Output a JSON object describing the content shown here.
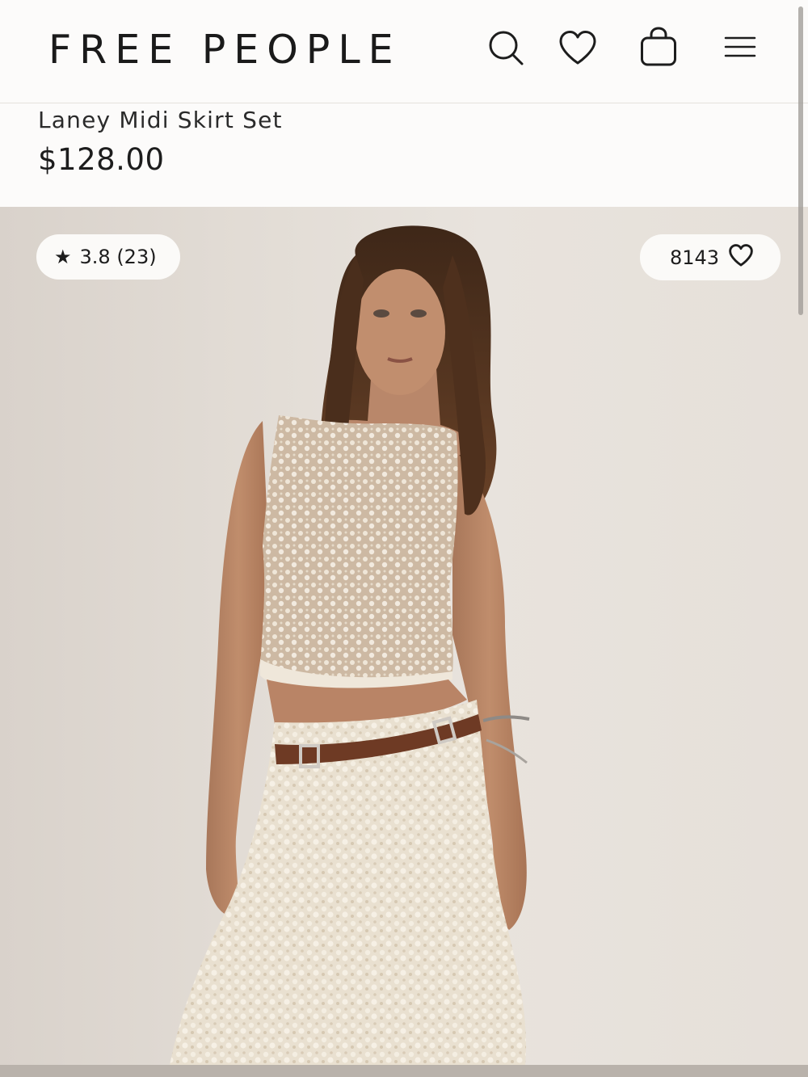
{
  "header": {
    "logo": "FREE PEOPLE",
    "icons": [
      "search-icon",
      "heart-icon",
      "shopping-bag-icon",
      "menu-icon"
    ]
  },
  "product": {
    "title": "Laney Midi Skirt Set",
    "price": "$128.00"
  },
  "badges": {
    "rating_star": "★",
    "rating_text": "3.8 (23)",
    "likes_count": "8143"
  },
  "colors": {
    "background": "#fcfbfa",
    "text": "#1d1d1d",
    "pill": "#fbfaf8"
  }
}
